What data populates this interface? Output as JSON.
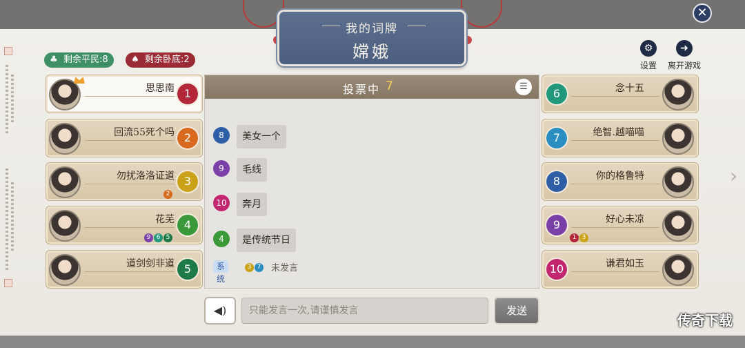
{
  "title_card": {
    "label": "我的词牌",
    "word": "嫦娥"
  },
  "stats": {
    "civilians": "剩余平民:8",
    "spies": "剩余卧底:2",
    "civilian_color": "#3f8f66",
    "spy_color": "#9b2c35"
  },
  "controls": {
    "settings": "设置",
    "leave": "离开游戏"
  },
  "players_left": [
    {
      "name": "思思南",
      "seat": "1",
      "color": "#b3263a",
      "me": true,
      "votes": []
    },
    {
      "name": "回流55死个吗",
      "seat": "2",
      "color": "#d76a1e",
      "votes": []
    },
    {
      "name": "勿扰洛洛证道",
      "seat": "3",
      "color": "#c9a21a",
      "votes": [
        {
          "n": "2",
          "color": "#d76a1e"
        }
      ]
    },
    {
      "name": "花芜",
      "seat": "4",
      "color": "#3a9a3a",
      "votes": [
        {
          "n": "9",
          "color": "#7b3fa8"
        },
        {
          "n": "6",
          "color": "#21977b"
        },
        {
          "n": "5",
          "color": "#1f7a4a"
        }
      ]
    },
    {
      "name": "道剑剑非道",
      "seat": "5",
      "color": "#1f7a4a",
      "votes": []
    }
  ],
  "players_right": [
    {
      "name": "念十五",
      "seat": "6",
      "color": "#21977b",
      "votes": []
    },
    {
      "name": "绝智.越喵喵",
      "seat": "7",
      "color": "#2a8fc0",
      "votes": []
    },
    {
      "name": "你的格鲁特",
      "seat": "8",
      "color": "#2e5ea6",
      "votes": []
    },
    {
      "name": "好心未凉",
      "seat": "9",
      "color": "#7b3fa8",
      "votes": [
        {
          "n": "1",
          "color": "#b3263a"
        },
        {
          "n": "3",
          "color": "#c9a21a"
        }
      ]
    },
    {
      "name": "谦君如玉",
      "seat": "10",
      "color": "#c2266e",
      "votes": []
    }
  ],
  "chat": {
    "status": "投票中",
    "count": "7",
    "messages": [
      {
        "seat": "8",
        "color": "#2e5ea6",
        "text": "美女一个"
      },
      {
        "seat": "9",
        "color": "#7b3fa8",
        "text": "毛线"
      },
      {
        "seat": "10",
        "color": "#c2266e",
        "text": "奔月"
      },
      {
        "seat": "4",
        "color": "#3a9a3a",
        "text": "是传统节日"
      }
    ],
    "system_tag": "系统",
    "system_dots": [
      {
        "n": "3",
        "color": "#c9a21a"
      },
      {
        "n": "7",
        "color": "#2a8fc0"
      }
    ],
    "system_text": "未发言"
  },
  "input": {
    "placeholder": "只能发言一次,请谨慎发言",
    "send": "发送"
  },
  "watermark": "传奇下载",
  "icons": {
    "close": "close-icon",
    "settings": "gear-icon",
    "leave": "exit-icon",
    "voice": "sound-icon",
    "list": "list-icon",
    "next": "chevron-right-icon"
  }
}
